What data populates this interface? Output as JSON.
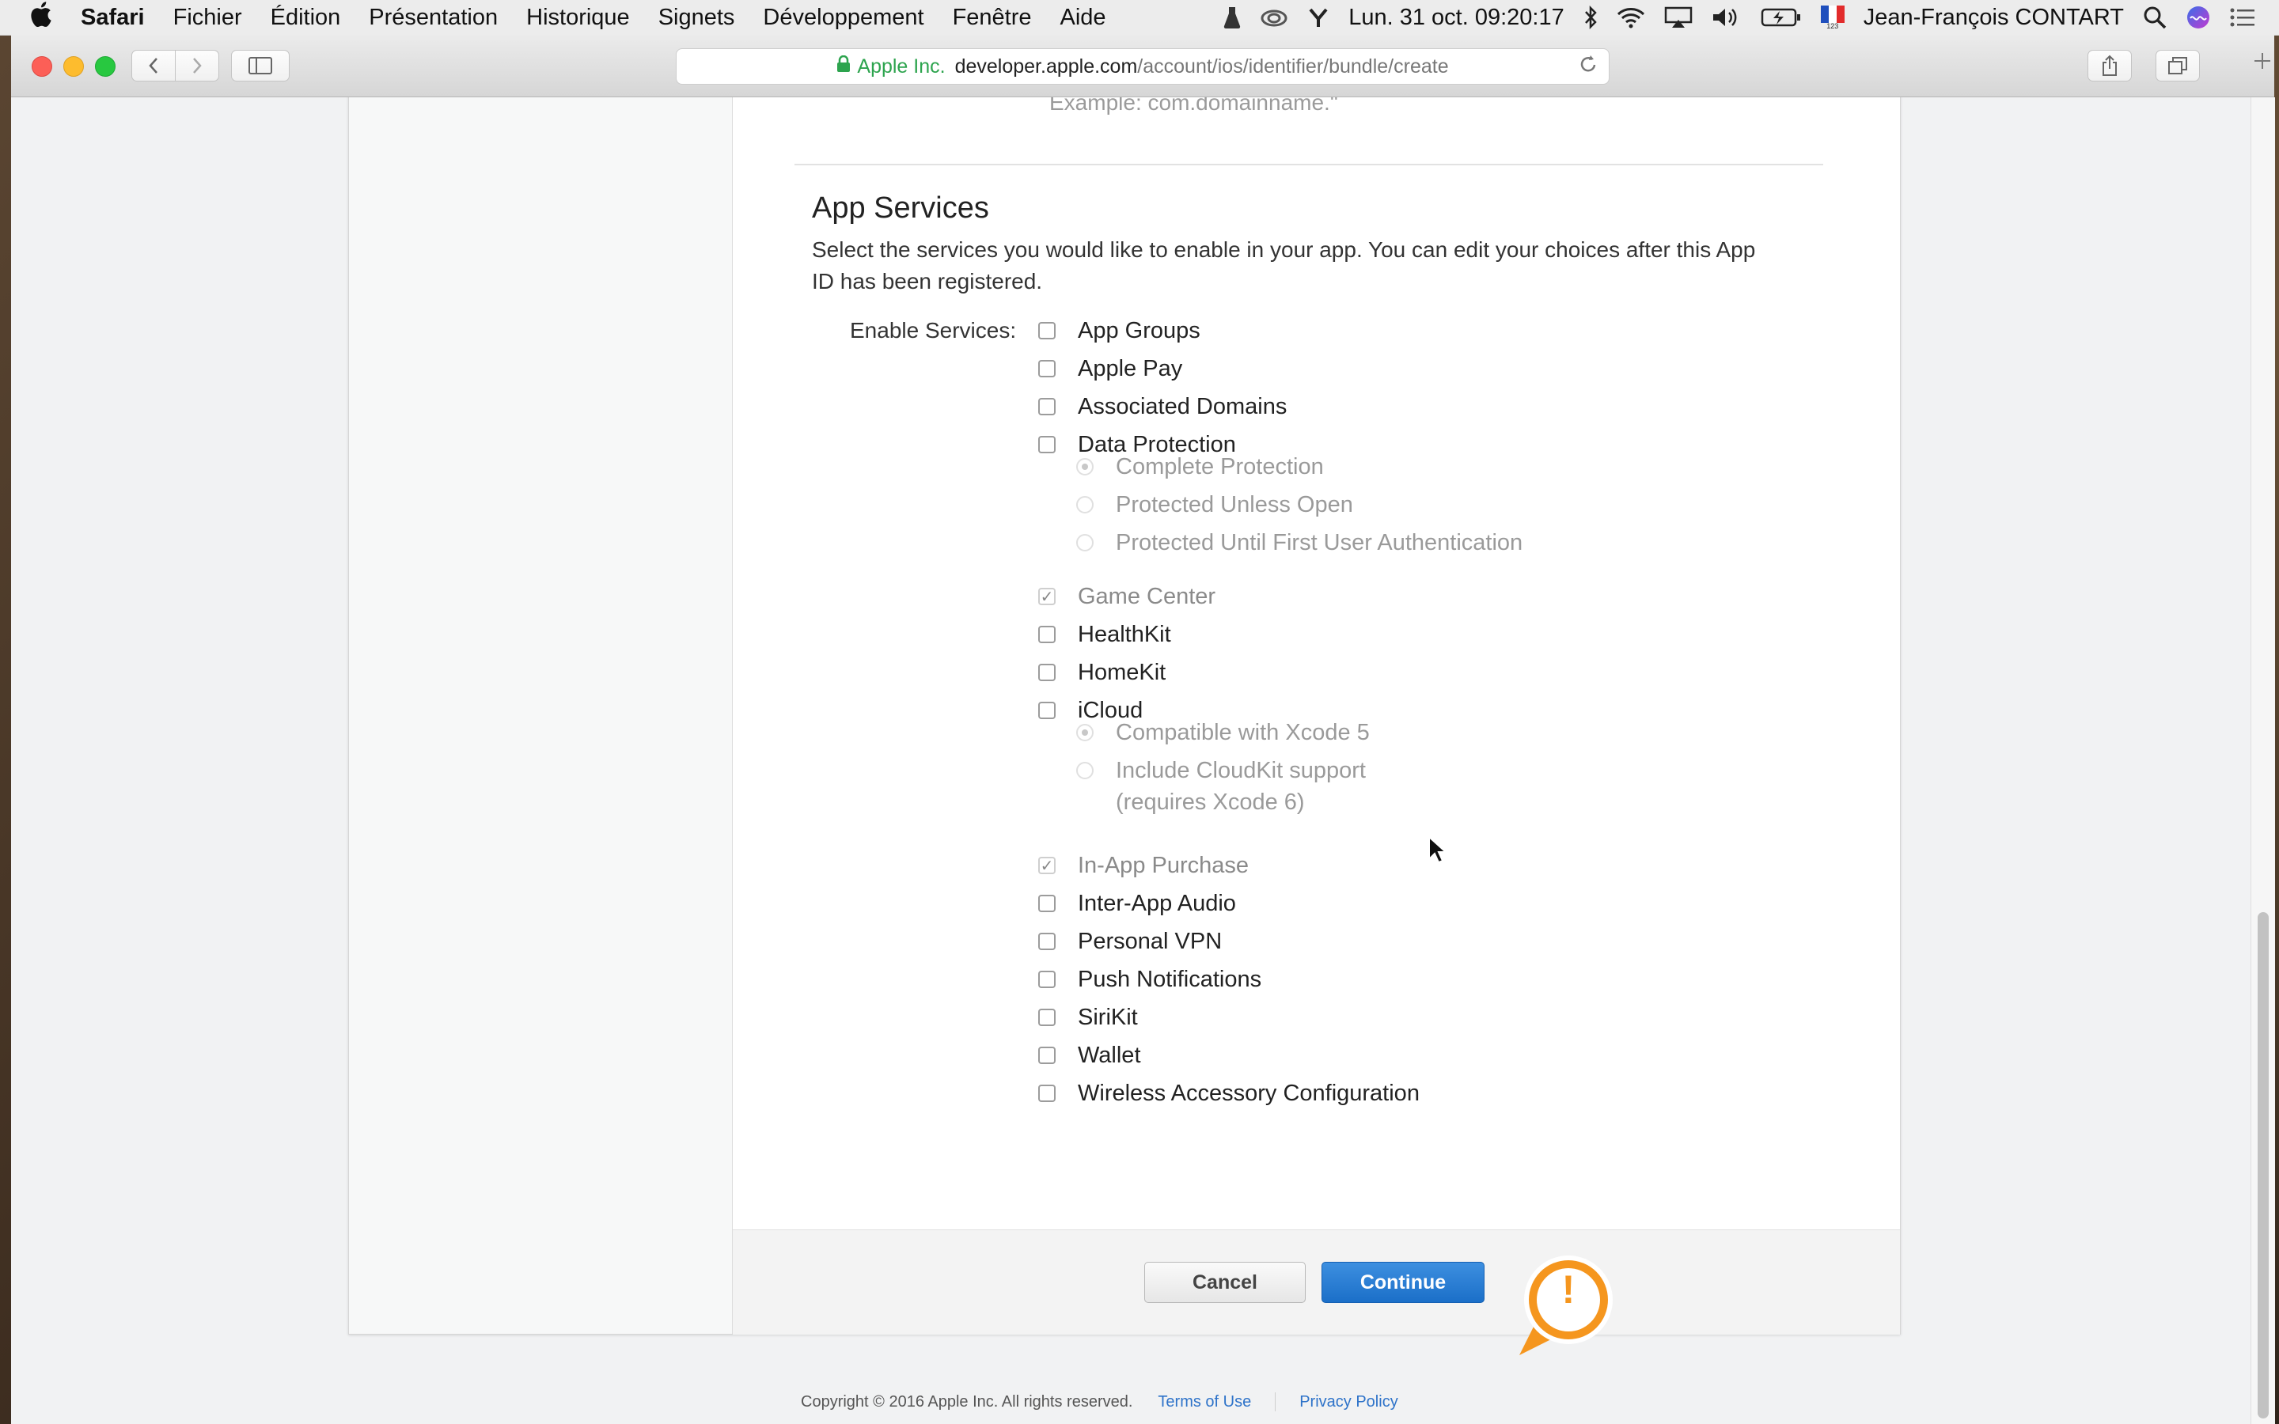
{
  "menubar": {
    "app": "Safari",
    "items": [
      "Fichier",
      "Édition",
      "Présentation",
      "Historique",
      "Signets",
      "Développement",
      "Fenêtre",
      "Aide"
    ],
    "clock": "Lun. 31 oct.  09:20:17",
    "user": "Jean-François CONTART",
    "input_source_sub": "123"
  },
  "browser": {
    "url_org": "Apple Inc.",
    "url_host": "developer.apple.com",
    "url_path": "/account/ios/identifier/bundle/create"
  },
  "page": {
    "example_text": "Example: com.domainname.\"",
    "section_title": "App Services",
    "section_desc": "Select the services you would like to enable in your app. You can edit your choices after this App ID has been registered.",
    "enable_label": "Enable Services:",
    "services": [
      {
        "label": "App Groups",
        "checked": false
      },
      {
        "label": "Apple Pay",
        "checked": false
      },
      {
        "label": "Associated Domains",
        "checked": false
      },
      {
        "label": "Data Protection",
        "checked": false
      },
      {
        "label": "Game Center",
        "checked": true
      },
      {
        "label": "HealthKit",
        "checked": false
      },
      {
        "label": "HomeKit",
        "checked": false
      },
      {
        "label": "iCloud",
        "checked": false
      },
      {
        "label": "In-App Purchase",
        "checked": true
      },
      {
        "label": "Inter-App Audio",
        "checked": false
      },
      {
        "label": "Personal VPN",
        "checked": false
      },
      {
        "label": "Push Notifications",
        "checked": false
      },
      {
        "label": "SiriKit",
        "checked": false
      },
      {
        "label": "Wallet",
        "checked": false
      },
      {
        "label": "Wireless Accessory Configuration",
        "checked": false
      }
    ],
    "data_protection_options": [
      "Complete Protection",
      "Protected Unless Open",
      "Protected Until First User Authentication"
    ],
    "icloud_options": [
      "Compatible with Xcode 5",
      "Include CloudKit support",
      "(requires Xcode 6)"
    ],
    "cancel_label": "Cancel",
    "continue_label": "Continue",
    "badge_symbol": "!",
    "copyright": "Copyright © 2016 Apple Inc. All rights reserved.",
    "terms": "Terms of Use",
    "privacy": "Privacy Policy"
  },
  "colors": {
    "accent": "#1b6fc8",
    "badge": "#f5961e",
    "link": "#2e73c9"
  }
}
